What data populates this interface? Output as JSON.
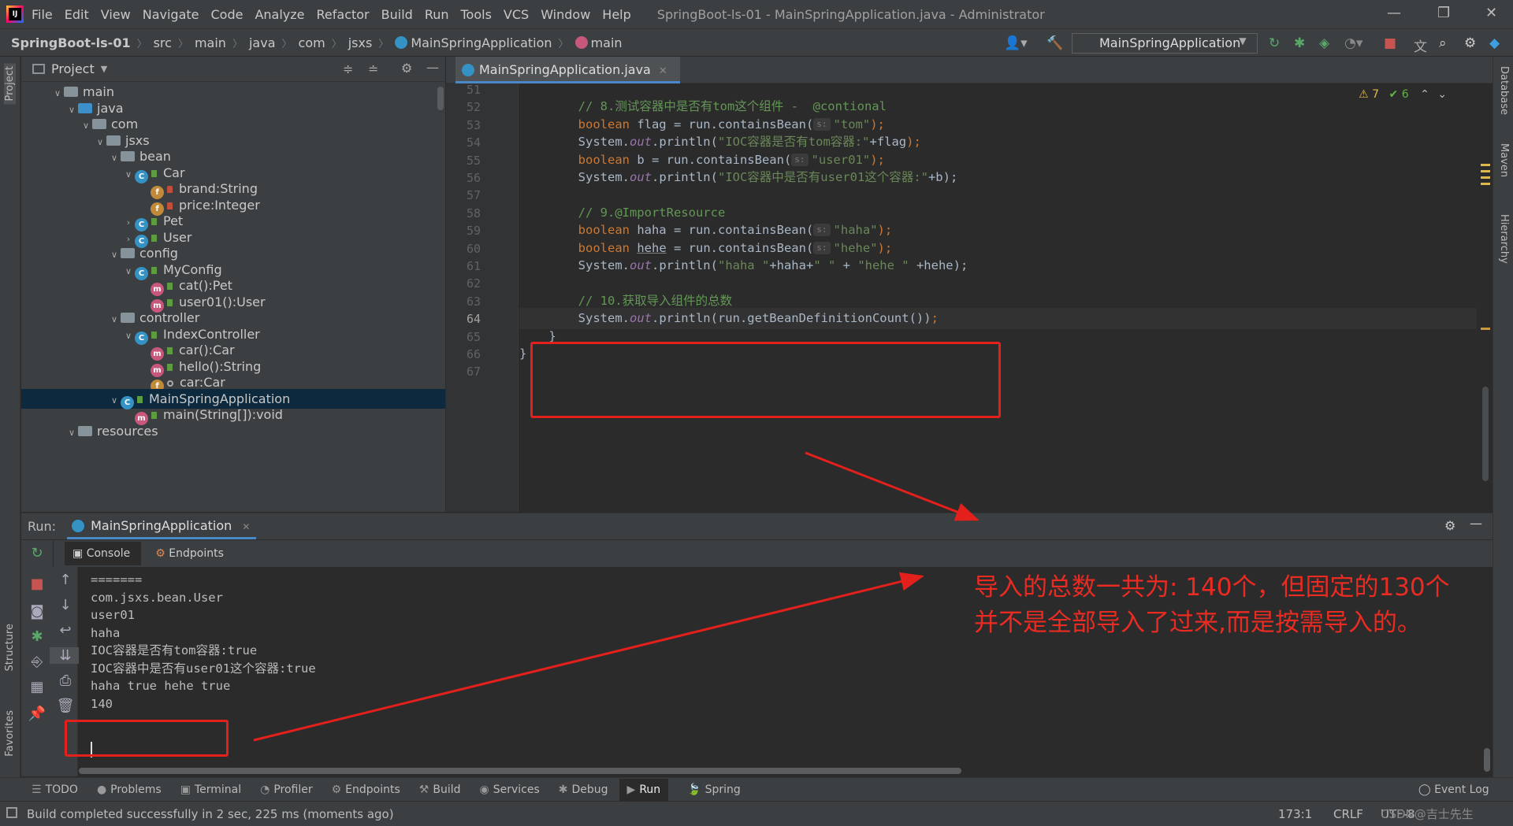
{
  "menu": [
    "File",
    "Edit",
    "View",
    "Navigate",
    "Code",
    "Analyze",
    "Refactor",
    "Build",
    "Run",
    "Tools",
    "VCS",
    "Window",
    "Help"
  ],
  "window_title": "SpringBoot-ls-01 - MainSpringApplication.java - Administrator",
  "window_controls": [
    "—",
    "❐",
    "✕"
  ],
  "breadcrumbs": [
    "SpringBoot-ls-01",
    "src",
    "main",
    "java",
    "com",
    "jsxs",
    "MainSpringApplication",
    "main"
  ],
  "run_config": "MainSpringApplication",
  "left_tabs": {
    "project": "Project",
    "structure": "Structure",
    "favorites": "Favorites"
  },
  "right_tabs": {
    "database": "Database",
    "maven": "Maven",
    "hierarchy": "Hierarchy"
  },
  "project_panel": {
    "title": "Project"
  },
  "tree": [
    {
      "label": "main",
      "indent": 0,
      "chev": "∨",
      "icon": "folder"
    },
    {
      "label": "java",
      "indent": 1,
      "chev": "∨",
      "icon": "folder-blue"
    },
    {
      "label": "com",
      "indent": 2,
      "chev": "∨",
      "icon": "folder"
    },
    {
      "label": "jsxs",
      "indent": 3,
      "chev": "∨",
      "icon": "folder"
    },
    {
      "label": "bean",
      "indent": 4,
      "chev": "∨",
      "icon": "folder"
    },
    {
      "label": "Car",
      "indent": 5,
      "chev": "∨",
      "icon": "class"
    },
    {
      "label": "brand:String",
      "indent": 6,
      "chev": "",
      "icon": "field"
    },
    {
      "label": "price:Integer",
      "indent": 6,
      "chev": "",
      "icon": "field"
    },
    {
      "label": "Pet",
      "indent": 5,
      "chev": "›",
      "icon": "class"
    },
    {
      "label": "User",
      "indent": 5,
      "chev": "›",
      "icon": "class"
    },
    {
      "label": "config",
      "indent": 4,
      "chev": "∨",
      "icon": "folder"
    },
    {
      "label": "MyConfig",
      "indent": 5,
      "chev": "∨",
      "icon": "class"
    },
    {
      "label": "cat():Pet",
      "indent": 6,
      "chev": "",
      "icon": "method"
    },
    {
      "label": "user01():User",
      "indent": 6,
      "chev": "",
      "icon": "method"
    },
    {
      "label": "controller",
      "indent": 4,
      "chev": "∨",
      "icon": "folder"
    },
    {
      "label": "IndexController",
      "indent": 5,
      "chev": "∨",
      "icon": "class"
    },
    {
      "label": "car():Car",
      "indent": 6,
      "chev": "",
      "icon": "method"
    },
    {
      "label": "hello():String",
      "indent": 6,
      "chev": "",
      "icon": "method"
    },
    {
      "label": "car:Car",
      "indent": 6,
      "chev": "",
      "icon": "field-pkg"
    },
    {
      "label": "MainSpringApplication",
      "indent": 4,
      "chev": "∨",
      "icon": "class",
      "selected": true
    },
    {
      "label": "main(String[]):void",
      "indent": 5,
      "chev": "",
      "icon": "method"
    },
    {
      "label": "resources",
      "indent": 1,
      "chev": "∨",
      "icon": "folder"
    }
  ],
  "editor": {
    "tab_label": "MainSpringApplication.java",
    "inspection_warnings": "⚠ 7",
    "inspection_ok": "✔ 6",
    "lines": [
      {
        "n": "51",
        "segs": [
          {
            "t": "",
            "c": ""
          }
        ]
      },
      {
        "n": "52",
        "segs": [
          {
            "t": "        // 8.测试容器中是否有tom这个组件 -  @contional",
            "c": "cmt"
          }
        ]
      },
      {
        "n": "53",
        "segs": [
          {
            "t": "        ",
            "c": ""
          },
          {
            "t": "boolean",
            "c": "kw"
          },
          {
            "t": " flag = run.containsBean(",
            "c": ""
          },
          {
            "t": "s:",
            "c": "hint"
          },
          {
            "t": "\"tom\"",
            "c": "str"
          },
          {
            "t": ");",
            "c": "kw"
          }
        ]
      },
      {
        "n": "54",
        "segs": [
          {
            "t": "        System.",
            "c": ""
          },
          {
            "t": "out",
            "c": "ital"
          },
          {
            "t": ".println(",
            "c": ""
          },
          {
            "t": "\"IOC容器是否有tom容器:\"",
            "c": "str"
          },
          {
            "t": "+flag",
            "c": ""
          },
          {
            "t": ");",
            "c": "kw"
          }
        ]
      },
      {
        "n": "55",
        "segs": [
          {
            "t": "        ",
            "c": ""
          },
          {
            "t": "boolean",
            "c": "kw"
          },
          {
            "t": " b = run.containsBean(",
            "c": ""
          },
          {
            "t": "s:",
            "c": "hint"
          },
          {
            "t": "\"user01\"",
            "c": "str"
          },
          {
            "t": ");",
            "c": "kw"
          }
        ]
      },
      {
        "n": "56",
        "segs": [
          {
            "t": "        System.",
            "c": ""
          },
          {
            "t": "out",
            "c": "ital"
          },
          {
            "t": ".println(",
            "c": ""
          },
          {
            "t": "\"IOC容器中是否有user01这个容器:\"",
            "c": "str"
          },
          {
            "t": "+b);",
            "c": ""
          }
        ]
      },
      {
        "n": "57",
        "segs": [
          {
            "t": "",
            "c": ""
          }
        ]
      },
      {
        "n": "58",
        "segs": [
          {
            "t": "        // 9.@ImportResource",
            "c": "cmt"
          }
        ]
      },
      {
        "n": "59",
        "segs": [
          {
            "t": "        ",
            "c": ""
          },
          {
            "t": "boolean",
            "c": "kw"
          },
          {
            "t": " haha = run.containsBean(",
            "c": ""
          },
          {
            "t": "s:",
            "c": "hint"
          },
          {
            "t": "\"haha\"",
            "c": "str"
          },
          {
            "t": ");",
            "c": "kw"
          }
        ]
      },
      {
        "n": "60",
        "segs": [
          {
            "t": "        ",
            "c": ""
          },
          {
            "t": "boolean",
            "c": "kw"
          },
          {
            "t": " ",
            "c": ""
          },
          {
            "t": "hehe",
            "c": "ul"
          },
          {
            "t": " = run.containsBean(",
            "c": ""
          },
          {
            "t": "s:",
            "c": "hint"
          },
          {
            "t": "\"hehe\"",
            "c": "str"
          },
          {
            "t": ");",
            "c": "kw"
          }
        ]
      },
      {
        "n": "61",
        "segs": [
          {
            "t": "        System.",
            "c": ""
          },
          {
            "t": "out",
            "c": "ital"
          },
          {
            "t": ".println(",
            "c": ""
          },
          {
            "t": "\"haha \"",
            "c": "str"
          },
          {
            "t": "+haha+",
            "c": ""
          },
          {
            "t": "\" \"",
            "c": "str"
          },
          {
            "t": " + ",
            "c": ""
          },
          {
            "t": "\"hehe \"",
            "c": "str"
          },
          {
            "t": " +hehe);",
            "c": ""
          }
        ]
      },
      {
        "n": "62",
        "segs": [
          {
            "t": "",
            "c": ""
          }
        ]
      },
      {
        "n": "63",
        "segs": [
          {
            "t": "        // 10.获取导入组件的总数",
            "c": "cmt"
          }
        ]
      },
      {
        "n": "64",
        "segs": [
          {
            "t": "        System.",
            "c": ""
          },
          {
            "t": "out",
            "c": "ital"
          },
          {
            "t": ".println(run.getBeanDefinitionCount())",
            "c": ""
          },
          {
            "t": ";",
            "c": "kw"
          }
        ],
        "current": true
      },
      {
        "n": "65",
        "segs": [
          {
            "t": "    }",
            "c": ""
          }
        ]
      },
      {
        "n": "66",
        "segs": [
          {
            "t": "}",
            "c": ""
          }
        ]
      },
      {
        "n": "67",
        "segs": [
          {
            "t": "",
            "c": ""
          }
        ]
      }
    ]
  },
  "run_panel": {
    "label": "Run:",
    "tab": "MainSpringApplication",
    "console_tab": "Console",
    "endpoints_tab": "Endpoints",
    "output": [
      "=======",
      "com.jsxs.bean.User",
      "user01",
      "haha",
      "IOC容器是否有tom容器:true",
      "IOC容器中是否有user01这个容器:true",
      "haha true hehe true",
      "140"
    ]
  },
  "annotation": {
    "line1": "导入的总数一共为: 140个，但固定的130个",
    "line2": "并不是全部导入了过来,而是按需导入的。"
  },
  "tool_windows": [
    "TODO",
    "Problems",
    "Terminal",
    "Profiler",
    "Endpoints",
    "Build",
    "Services",
    "Debug",
    "Run",
    "Spring"
  ],
  "event_log": "Event Log",
  "status": {
    "message": "Build completed successfully in 2 sec, 225 ms (moments ago)",
    "position": "173:1",
    "line_sep": "CRLF",
    "encoding": "UTF-8",
    "watermark": "CSDN@吉士先生"
  },
  "colors": {
    "annotation_red": "#e3201c",
    "accent_blue": "#4a88c7"
  }
}
